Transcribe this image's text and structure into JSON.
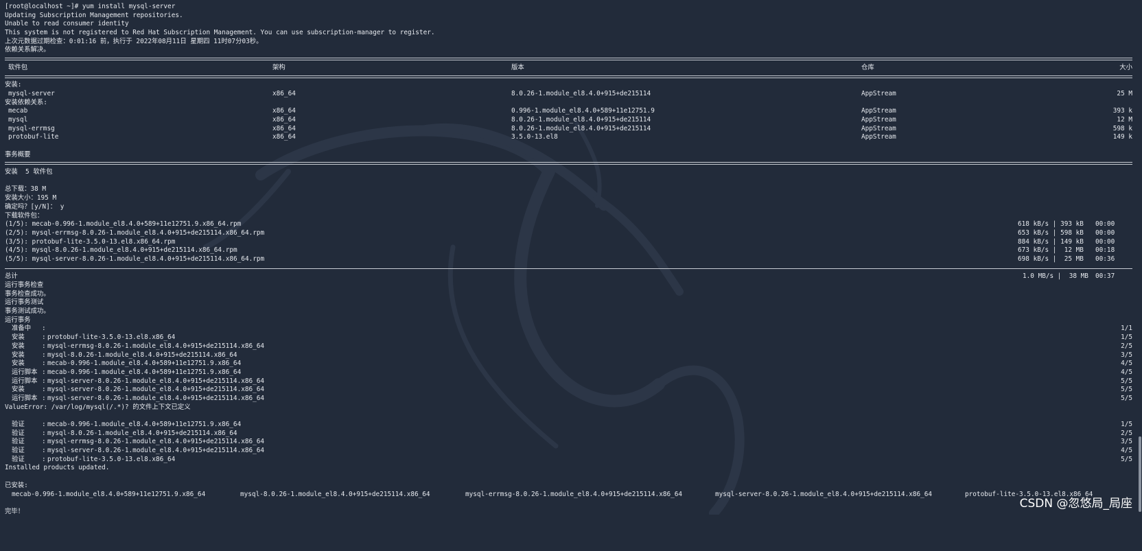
{
  "prompt": "[root@localhost ~]# yum install mysql-server",
  "preamble": [
    "Updating Subscription Management repositories.",
    "Unable to read consumer identity",
    "This system is not registered to Red Hat Subscription Management. You can use subscription-manager to register.",
    "上次元数据过期检查：0:01:16 前，执行于 2022年08月11日 星期四 11时07分03秒。",
    "依赖关系解决。"
  ],
  "table": {
    "headers": [
      "软件包",
      "架构",
      "版本",
      "仓库",
      "大小"
    ],
    "install_label": "安装:",
    "deps_label": "安装依赖关系:",
    "install_rows": [
      {
        "name": "mysql-server",
        "arch": "x86_64",
        "version": "8.0.26-1.module_el8.4.0+915+de215114",
        "repo": "AppStream",
        "size": "25 M"
      }
    ],
    "dep_rows": [
      {
        "name": "mecab",
        "arch": "x86_64",
        "version": "0.996-1.module_el8.4.0+589+11e12751.9",
        "repo": "AppStream",
        "size": "393 k"
      },
      {
        "name": "mysql",
        "arch": "x86_64",
        "version": "8.0.26-1.module_el8.4.0+915+de215114",
        "repo": "AppStream",
        "size": "12 M"
      },
      {
        "name": "mysql-errmsg",
        "arch": "x86_64",
        "version": "8.0.26-1.module_el8.4.0+915+de215114",
        "repo": "AppStream",
        "size": "598 k"
      },
      {
        "name": "protobuf-lite",
        "arch": "x86_64",
        "version": "3.5.0-13.el8",
        "repo": "AppStream",
        "size": "149 k"
      }
    ]
  },
  "summary": {
    "title": "事务概要",
    "install_count": "安装  5 软件包",
    "total_download": "总下载：38 M",
    "install_size": "安装大小：195 M",
    "confirm": "确定吗？[y/N]： y",
    "downloading": "下载软件包："
  },
  "downloads": [
    {
      "file": "(1/5): mecab-0.996-1.module_el8.4.0+589+11e12751.9.x86_64.rpm",
      "rate": "618 kB/s | 393 kB",
      "time": "00:00"
    },
    {
      "file": "(2/5): mysql-errmsg-8.0.26-1.module_el8.4.0+915+de215114.x86_64.rpm",
      "rate": "653 kB/s | 598 kB",
      "time": "00:00"
    },
    {
      "file": "(3/5): protobuf-lite-3.5.0-13.el8.x86_64.rpm",
      "rate": "884 kB/s | 149 kB",
      "time": "00:00"
    },
    {
      "file": "(4/5): mysql-8.0.26-1.module_el8.4.0+915+de215114.x86_64.rpm",
      "rate": "673 kB/s |  12 MB",
      "time": "00:18"
    },
    {
      "file": "(5/5): mysql-server-8.0.26-1.module_el8.4.0+915+de215114.x86_64.rpm",
      "rate": "698 kB/s |  25 MB",
      "time": "00:36"
    }
  ],
  "total": {
    "label": "总计",
    "rate": "1.0 MB/s |  38 MB",
    "time": "00:37"
  },
  "transaction_lines": [
    "运行事务检查",
    "事务检查成功。",
    "运行事务测试",
    "事务测试成功。",
    "运行事务"
  ],
  "steps": [
    {
      "verb": "准备中  ",
      "pkg": "",
      "n": "1/1"
    },
    {
      "verb": "安装    ",
      "pkg": "protobuf-lite-3.5.0-13.el8.x86_64",
      "n": "1/5"
    },
    {
      "verb": "安装    ",
      "pkg": "mysql-errmsg-8.0.26-1.module_el8.4.0+915+de215114.x86_64",
      "n": "2/5"
    },
    {
      "verb": "安装    ",
      "pkg": "mysql-8.0.26-1.module_el8.4.0+915+de215114.x86_64",
      "n": "3/5"
    },
    {
      "verb": "安装    ",
      "pkg": "mecab-0.996-1.module_el8.4.0+589+11e12751.9.x86_64",
      "n": "4/5"
    },
    {
      "verb": "运行脚本",
      "pkg": "mecab-0.996-1.module_el8.4.0+589+11e12751.9.x86_64",
      "n": "4/5"
    },
    {
      "verb": "运行脚本",
      "pkg": "mysql-server-8.0.26-1.module_el8.4.0+915+de215114.x86_64",
      "n": "5/5"
    },
    {
      "verb": "安装    ",
      "pkg": "mysql-server-8.0.26-1.module_el8.4.0+915+de215114.x86_64",
      "n": "5/5"
    },
    {
      "verb": "运行脚本",
      "pkg": "mysql-server-8.0.26-1.module_el8.4.0+915+de215114.x86_64",
      "n": "5/5"
    }
  ],
  "value_error": "ValueError: /var/log/mysql(/.*)? 的文件上下文已定义",
  "verify": [
    {
      "verb": "验证    ",
      "pkg": "mecab-0.996-1.module_el8.4.0+589+11e12751.9.x86_64",
      "n": "1/5"
    },
    {
      "verb": "验证    ",
      "pkg": "mysql-8.0.26-1.module_el8.4.0+915+de215114.x86_64",
      "n": "2/5"
    },
    {
      "verb": "验证    ",
      "pkg": "mysql-errmsg-8.0.26-1.module_el8.4.0+915+de215114.x86_64",
      "n": "3/5"
    },
    {
      "verb": "验证    ",
      "pkg": "mysql-server-8.0.26-1.module_el8.4.0+915+de215114.x86_64",
      "n": "4/5"
    },
    {
      "verb": "验证    ",
      "pkg": "protobuf-lite-3.5.0-13.el8.x86_64",
      "n": "5/5"
    }
  ],
  "installed_updated": "Installed products updated.",
  "installed_label": "已安装:",
  "installed": [
    "mecab-0.996-1.module_el8.4.0+589+11e12751.9.x86_64",
    "mysql-8.0.26-1.module_el8.4.0+915+de215114.x86_64",
    "mysql-errmsg-8.0.26-1.module_el8.4.0+915+de215114.x86_64",
    "mysql-server-8.0.26-1.module_el8.4.0+915+de215114.x86_64",
    "protobuf-lite-3.5.0-13.el8.x86_64"
  ],
  "done": "完毕！",
  "watermark": "CSDN @忽悠局_局座",
  "colors": {
    "background": "#222b3a",
    "text": "#e6e9ee"
  },
  "background_icon": "kali-dragon-icon"
}
